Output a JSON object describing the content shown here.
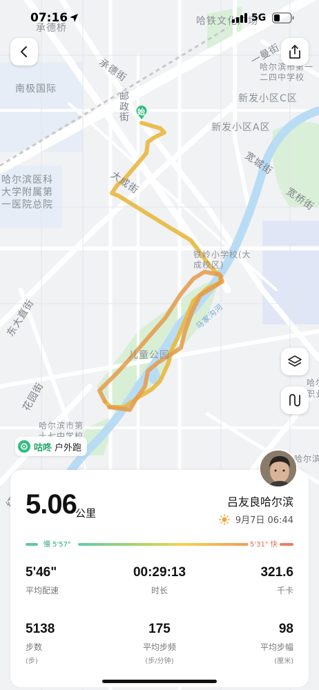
{
  "status_bar": {
    "time": "07:16",
    "network": "5G"
  },
  "map": {
    "labels": {
      "chengde_bridge": "承德桥",
      "hatie_culture": "哈铁文化广场",
      "nanji": "南极国际",
      "chengde_street": "承德街",
      "youzheng_street": "邮政街",
      "xinfa_c": "新发小区C区",
      "xinfa_a": "新发小区A区",
      "yiman_street": "一曼街",
      "harbin_124": "哈尔滨市第一二四中学校",
      "hospital": "哈尔滨医科大学附属第一医院总院",
      "dacheng_street": "大成街",
      "kuancheng_street": "宽城街",
      "kuanqiao_street": "宽桥街",
      "tieling_school": "铁岭小学校(大成校区)",
      "majiagou_river": "马家沟河",
      "dongdazhi_street": "东大直街",
      "childrens_park": "儿童公园",
      "huayuan_street": "花园街",
      "harbin_17": "哈尔滨市第十七中学校",
      "harbin_right": "哈尔滨市第",
      "hongjun_street": "红军街",
      "right_edge_1": "哈尔",
      "right_edge_2": "职业",
      "start_marker": "始"
    }
  },
  "app_badge": {
    "name": "咕咚",
    "type": "户外跑"
  },
  "card": {
    "distance": "5.06",
    "distance_unit": "公里",
    "username": "吕友良哈尔滨",
    "date": "9月7日 06:44",
    "pace_slow_label": "慢 5'57\"",
    "pace_fast_label": "5'31\" 快",
    "stats": {
      "avg_pace": {
        "value": "5'46\"",
        "label": "平均配速"
      },
      "duration": {
        "value": "00:29:13",
        "label": "时长"
      },
      "calories": {
        "value": "321.6",
        "label": "千卡"
      },
      "steps": {
        "value": "5138",
        "label": "步数",
        "unit": "(步)"
      },
      "cadence": {
        "value": "175",
        "label": "平均步频",
        "unit": "(步/分钟)"
      },
      "stride": {
        "value": "98",
        "label": "平均步幅",
        "unit": "(厘米)"
      }
    }
  },
  "colors": {
    "route": "#e8b83e",
    "route_end": "#e59a4a",
    "brand_green": "#2dbf7c",
    "river": "#b9dcf5",
    "park": "#d8efd6"
  },
  "icons": [
    "back-arrow-icon",
    "share-icon",
    "layers-icon",
    "route-icon",
    "sun-icon",
    "location-arrow-icon",
    "signal-icon",
    "battery-icon",
    "app-logo-icon"
  ]
}
